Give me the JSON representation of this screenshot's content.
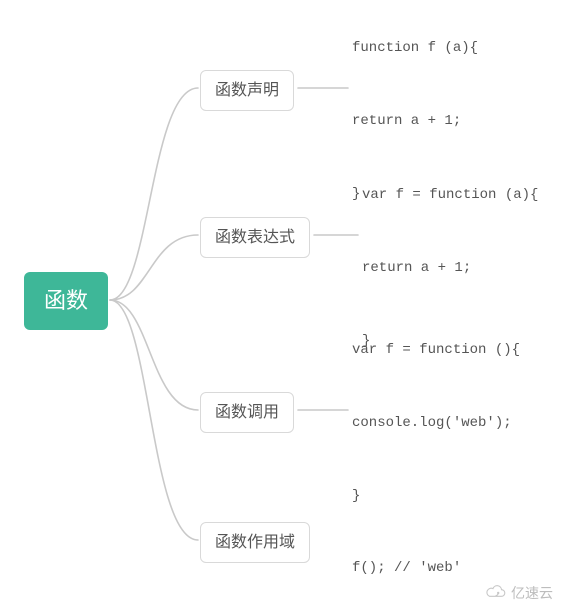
{
  "root": {
    "label": "函数"
  },
  "children": [
    {
      "label": "函数声明",
      "code": "function f (a){\n\nreturn a + 1;\n\n}"
    },
    {
      "label": "函数表达式",
      "code": "var f = function (a){\n\nreturn a + 1;\n\n}"
    },
    {
      "label": "函数调用",
      "code": "var f = function (){\n\nconsole.log('web');\n\n}\n\nf(); // 'web'"
    },
    {
      "label": "函数作用域",
      "code": ""
    }
  ],
  "watermark": "亿速云",
  "chart_data": {
    "type": "mindmap",
    "root": "函数",
    "branches": [
      {
        "name": "函数声明",
        "leaf": "function f (a){ return a + 1; }"
      },
      {
        "name": "函数表达式",
        "leaf": "var f = function (a){ return a + 1; }"
      },
      {
        "name": "函数调用",
        "leaf": "var f = function (){ console.log('web'); } f(); // 'web'"
      },
      {
        "name": "函数作用域",
        "leaf": null
      }
    ]
  }
}
